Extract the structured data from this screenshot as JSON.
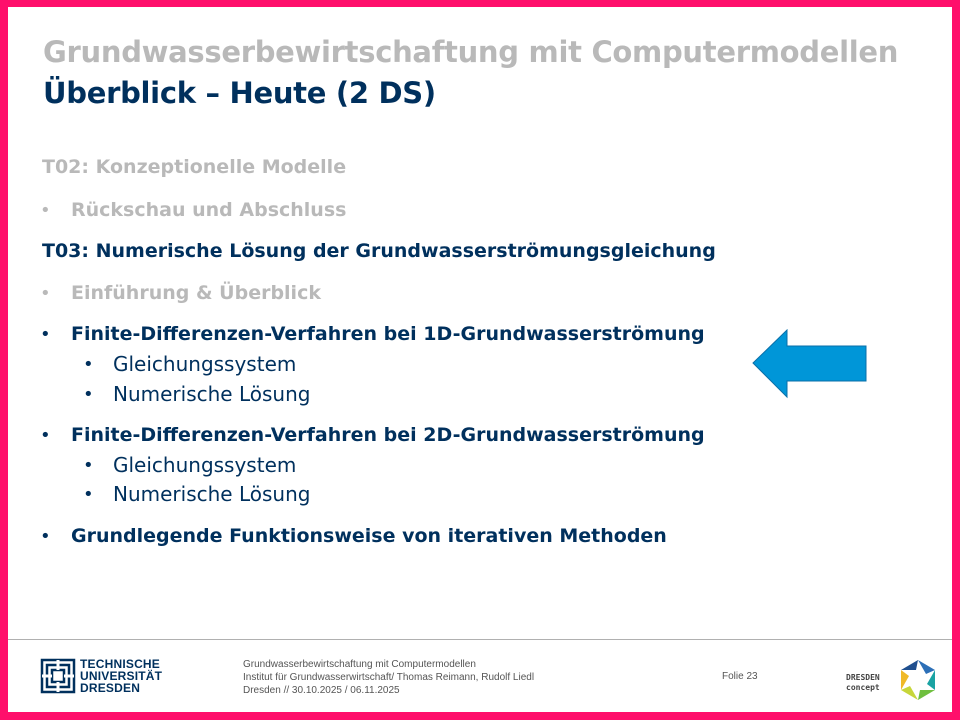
{
  "header": {
    "title": "Grundwasserbewirtschaftung mit Computermodellen",
    "subtitle": "Überblick – Heute (2 DS)"
  },
  "agenda": {
    "t02_heading": "T02: Konzeptionelle  Modelle",
    "t02_item": "Rückschau und Abschluss",
    "t03_heading": "T03: Numerische Lösung der Grundwasserströmungsgleichung",
    "item_intro": "Einführung & Überblick",
    "item_1d": "Finite-Differenzen-Verfahren  bei  1D-Grundwasserströmung",
    "item_1d_sub": [
      "Gleichungssystem",
      "Numerische Lösung"
    ],
    "item_2d": "Finite-Differenzen-Verfahren  bei  2D-Grundwasserströmung",
    "item_2d_sub": [
      "Gleichungssystem",
      "Numerische Lösung"
    ],
    "item_iter": "Grundlegende  Funktionsweise  von iterativen  Methoden"
  },
  "footer": {
    "line1": "Grundwasserbewirtschaftung mit Computermodellen",
    "line2": "Institut für Grundwasserwirtschaft/ Thomas Reimann, Rudolf Liedl",
    "line3": "Dresden // 30.10.2025  / 06.11.2025",
    "folio": "Folie 23",
    "tud_logo": [
      "TECHNISCHE",
      "UNIVERSITÄT",
      "DRESDEN"
    ],
    "dc_logo": [
      "DRESDEN",
      "concept"
    ]
  },
  "colors": {
    "frame": "#ff0f6b",
    "primary": "#00305d",
    "muted": "#b9b9b9",
    "arrow": "#0096d8"
  },
  "icons": {
    "arrow": "left-arrow-icon",
    "tud": "tud-logo-icon",
    "dresden_concept": "dresden-concept-logo-icon"
  }
}
